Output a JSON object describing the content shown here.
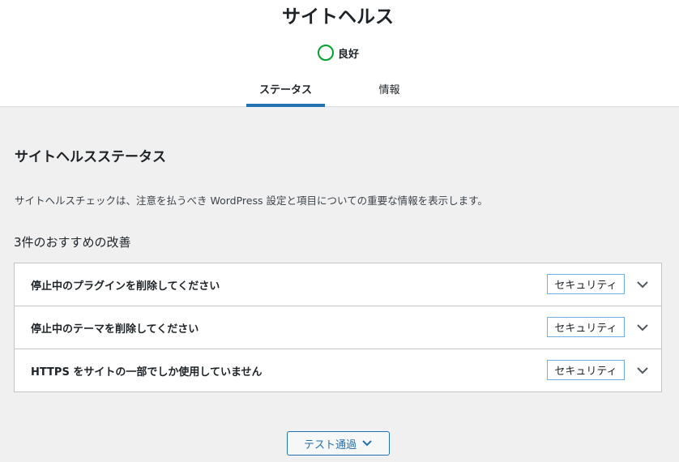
{
  "header": {
    "title": "サイトヘルス",
    "status_label": "良好",
    "status_color": "#00a32a"
  },
  "tabs": [
    {
      "label": "ステータス",
      "active": true
    },
    {
      "label": "情報",
      "active": false
    }
  ],
  "main": {
    "section_title": "サイトヘルスステータス",
    "description": "サイトヘルスチェックは、注意を払うべき WordPress 設定と項目についての重要な情報を表示します。",
    "count_heading": "3件のおすすめの改善",
    "issues": [
      {
        "label": "停止中のプラグインを削除してください",
        "badge": "セキュリティ",
        "icon": "chevron-down-icon"
      },
      {
        "label": "停止中のテーマを削除してください",
        "badge": "セキュリティ",
        "icon": "chevron-down-icon"
      },
      {
        "label": "HTTPS をサイトの一部でしか使用していません",
        "badge": "セキュリティ",
        "icon": "chevron-down-icon"
      }
    ],
    "passed_button_label": "テスト通過"
  },
  "colors": {
    "accent": "#2271b1",
    "badge_border": "#72aee6"
  }
}
